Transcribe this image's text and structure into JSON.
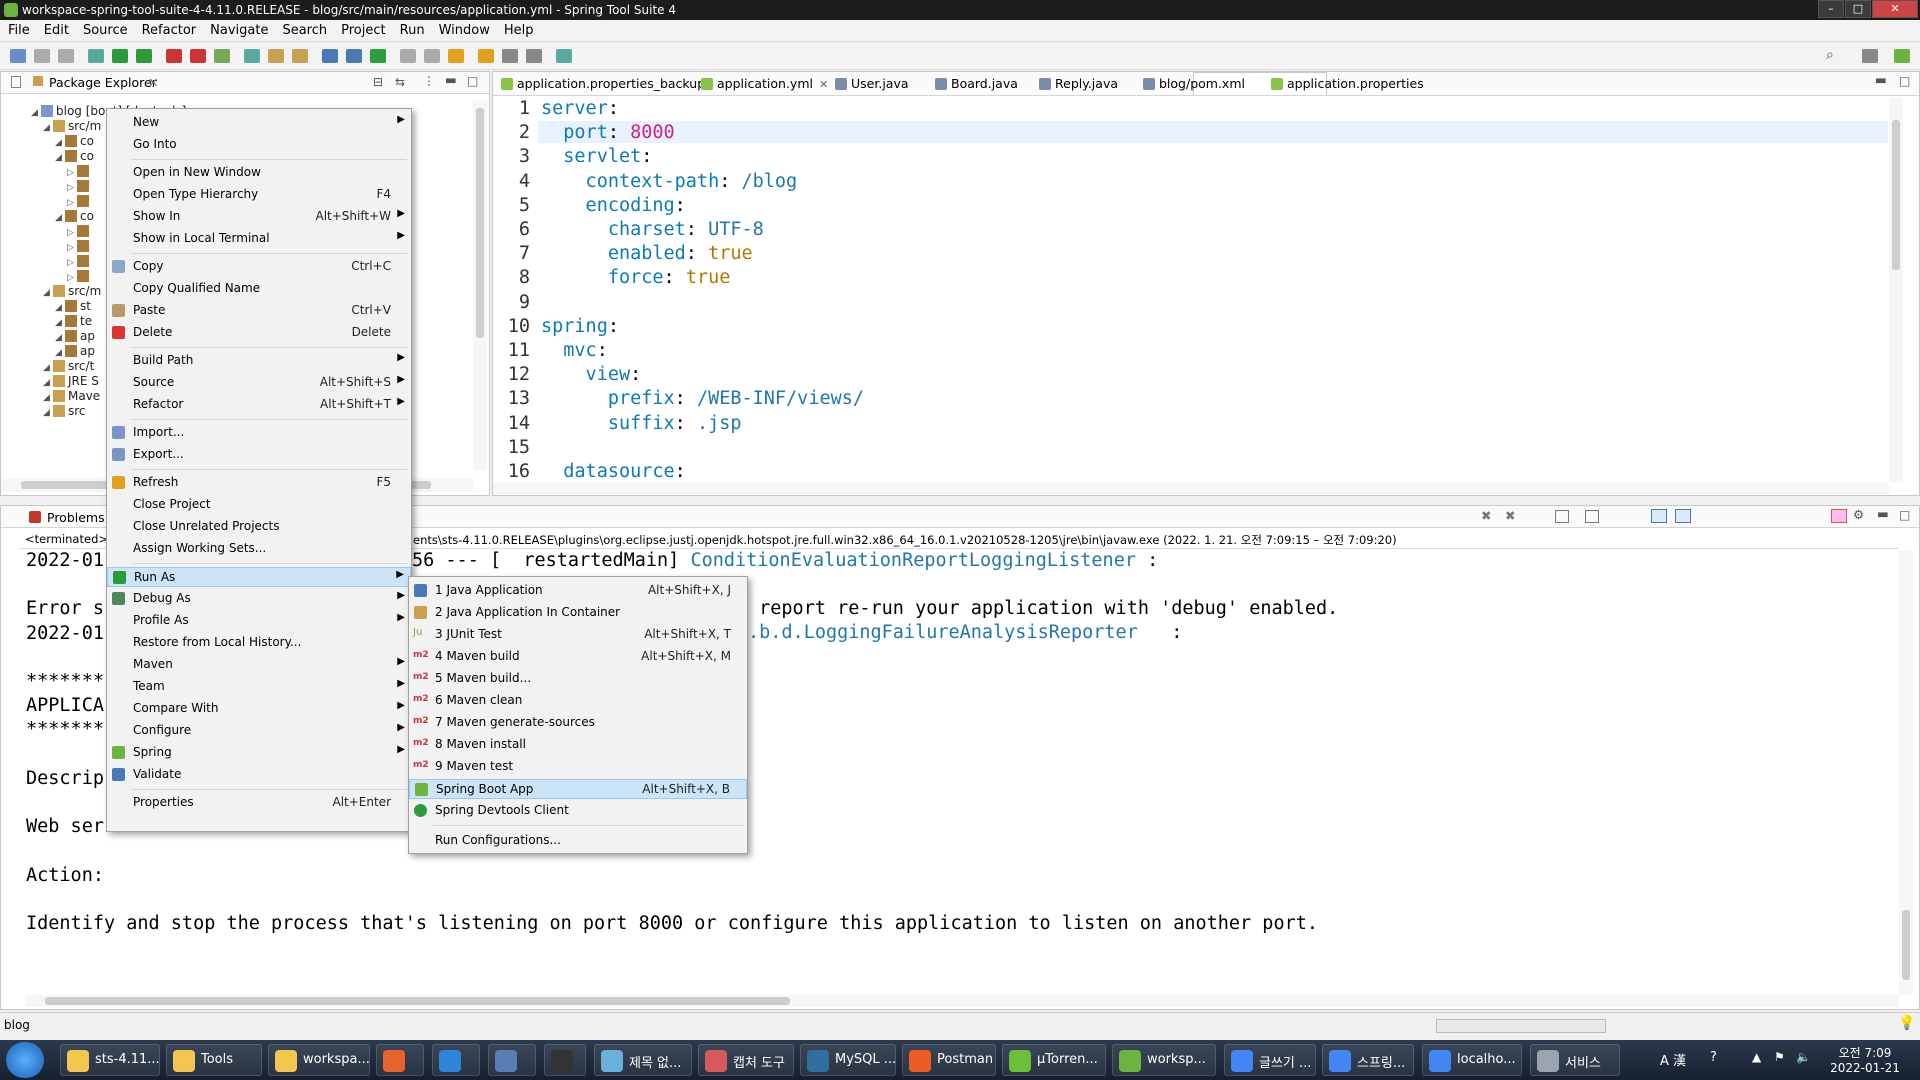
{
  "window": {
    "title": "workspace-spring-tool-suite-4-4.11.0.RELEASE - blog/src/main/resources/application.yml - Spring Tool Suite 4"
  },
  "menubar": [
    "File",
    "Edit",
    "Source",
    "Refactor",
    "Navigate",
    "Search",
    "Project",
    "Run",
    "Window",
    "Help"
  ],
  "package_explorer": {
    "tab_label": "Package Explorer",
    "tree": [
      {
        "label": "blog [boot] [devtools]",
        "indent": 0
      },
      {
        "label": "src/m",
        "indent": 1
      },
      {
        "label": "co",
        "indent": 2
      },
      {
        "label": "co",
        "indent": 2
      },
      {
        "label": "",
        "indent": 3
      },
      {
        "label": "",
        "indent": 3
      },
      {
        "label": "",
        "indent": 3
      },
      {
        "label": "co",
        "indent": 2
      },
      {
        "label": "",
        "indent": 3
      },
      {
        "label": "",
        "indent": 3
      },
      {
        "label": "",
        "indent": 3
      },
      {
        "label": "",
        "indent": 3
      },
      {
        "label": "src/m",
        "indent": 1
      },
      {
        "label": "st",
        "indent": 2
      },
      {
        "label": "te",
        "indent": 2
      },
      {
        "label": "ap",
        "indent": 2
      },
      {
        "label": "ap",
        "indent": 2
      },
      {
        "label": "src/t",
        "indent": 1
      },
      {
        "label": "JRE S",
        "indent": 1
      },
      {
        "label": "Mave",
        "indent": 1
      },
      {
        "label": "src",
        "indent": 1
      }
    ]
  },
  "editor": {
    "tabs": [
      {
        "label": "application.properties_backup",
        "color": "#8bc34a"
      },
      {
        "label": "application.yml",
        "color": "#8bc34a",
        "active": true
      },
      {
        "label": "User.java",
        "color": "#7a8ba8"
      },
      {
        "label": "Board.java",
        "color": "#7a8ba8"
      },
      {
        "label": "Reply.java",
        "color": "#7a8ba8"
      },
      {
        "label": "blog/pom.xml",
        "color": "#7a8ba8"
      },
      {
        "label": "application.properties",
        "color": "#8bc34a"
      }
    ],
    "close_glyph": "✕",
    "line_numbers": [
      "1",
      "2",
      "3",
      "4",
      "5",
      "6",
      "7",
      "8",
      "9",
      "10",
      "11",
      "12",
      "13",
      "14",
      "15",
      "16"
    ],
    "lines": [
      [
        {
          "t": "server",
          "c": "key"
        },
        {
          "t": ":",
          "c": ""
        }
      ],
      [
        {
          "t": "  port",
          "c": "key"
        },
        {
          "t": ": ",
          "c": ""
        },
        {
          "t": "8000",
          "c": "num"
        }
      ],
      [
        {
          "t": "  servlet",
          "c": "key"
        },
        {
          "t": ":",
          "c": ""
        }
      ],
      [
        {
          "t": "    context-path",
          "c": "key"
        },
        {
          "t": ": ",
          "c": ""
        },
        {
          "t": "/blog",
          "c": "str"
        }
      ],
      [
        {
          "t": "    encoding",
          "c": "key"
        },
        {
          "t": ":",
          "c": ""
        }
      ],
      [
        {
          "t": "      charset",
          "c": "key"
        },
        {
          "t": ": ",
          "c": ""
        },
        {
          "t": "UTF-8",
          "c": "str"
        }
      ],
      [
        {
          "t": "      enabled",
          "c": "key"
        },
        {
          "t": ": ",
          "c": ""
        },
        {
          "t": "true",
          "c": "bool"
        }
      ],
      [
        {
          "t": "      force",
          "c": "key"
        },
        {
          "t": ": ",
          "c": ""
        },
        {
          "t": "true",
          "c": "bool"
        }
      ],
      [],
      [
        {
          "t": "spring",
          "c": "key"
        },
        {
          "t": ":",
          "c": ""
        }
      ],
      [
        {
          "t": "  mvc",
          "c": "key"
        },
        {
          "t": ":",
          "c": ""
        }
      ],
      [
        {
          "t": "    view",
          "c": "key"
        },
        {
          "t": ":",
          "c": ""
        }
      ],
      [
        {
          "t": "      prefix",
          "c": "key"
        },
        {
          "t": ": ",
          "c": ""
        },
        {
          "t": "/WEB-INF/views/",
          "c": "str"
        }
      ],
      [
        {
          "t": "      suffix",
          "c": "key"
        },
        {
          "t": ": ",
          "c": ""
        },
        {
          "t": ".jsp",
          "c": "str"
        }
      ],
      [],
      [
        {
          "t": "  datasource",
          "c": "key"
        },
        {
          "t": ":",
          "c": ""
        }
      ]
    ]
  },
  "console": {
    "tab_label": "Problems",
    "terminated_label": "<terminated> b",
    "path_text": "ents\\sts-4.11.0.RELEASE\\plugins\\org.eclipse.justj.openjdk.hotspot.jre.full.win32.x86_64_16.0.1.v20210528-1205\\jre\\bin\\javaw.exe  (2022. 1. 21. 오전 7:09:15 – 오전 7:09:20)",
    "lines": [
      {
        "text": "2022-01",
        "ms": 56
      },
      {
        "text": "",
        "ms": 0
      },
      {
        "text": "Error s",
        "ms": 0
      },
      {
        "text": "2022-01",
        "ms": 0
      },
      {
        "text": "",
        "ms": 0
      },
      {
        "text": "*******",
        "ms": 0
      },
      {
        "text": "APPLICA",
        "ms": 0
      },
      {
        "text": "*******",
        "ms": 0
      },
      {
        "text": "",
        "ms": 0
      },
      {
        "text": "Descrip",
        "ms": 0
      },
      {
        "text": "",
        "ms": 0
      },
      {
        "text": "Web ser",
        "ms": 0
      },
      {
        "text": "",
        "ms": 0
      },
      {
        "text": "Action:",
        "ms": 0
      },
      {
        "text": "",
        "ms": 0
      },
      {
        "text": "Identify and stop the process that's listening on port 8000 or configure this application to listen on another port.",
        "ms": 0
      }
    ],
    "right_fragments": [
      {
        "text": "56 --- [  restartedMain] ",
        "cls": ""
      },
      {
        "text": "ConditionEvaluationReportLoggingListener",
        "cls": "str"
      },
      {
        "text": " :",
        "cls": ""
      }
    ],
    "fragment2": " report re-run your application with 'debug' enabled.",
    "fragment3a": ".b.d.LoggingFailureAnalysisReporter",
    "fragment3b": "   :"
  },
  "context_menu": {
    "items": [
      {
        "label": "New",
        "shortcut": "",
        "arrow": true,
        "icon": ""
      },
      {
        "label": "Go Into",
        "shortcut": "",
        "arrow": false,
        "icon": ""
      },
      {
        "sep": true
      },
      {
        "label": "Open in New Window",
        "shortcut": "",
        "arrow": false,
        "icon": ""
      },
      {
        "label": "Open Type Hierarchy",
        "shortcut": "F4",
        "arrow": false,
        "icon": ""
      },
      {
        "label": "Show In",
        "shortcut": "Alt+Shift+W",
        "arrow": true,
        "icon": ""
      },
      {
        "label": "Show in Local Terminal",
        "shortcut": "",
        "arrow": true,
        "icon": ""
      },
      {
        "sep": true
      },
      {
        "label": "Copy",
        "shortcut": "Ctrl+C",
        "arrow": false,
        "icon": "copy-icon"
      },
      {
        "label": "Copy Qualified Name",
        "shortcut": "",
        "arrow": false,
        "icon": ""
      },
      {
        "label": "Paste",
        "shortcut": "Ctrl+V",
        "arrow": false,
        "icon": "paste-icon"
      },
      {
        "label": "Delete",
        "shortcut": "Delete",
        "arrow": false,
        "icon": "delete-icon"
      },
      {
        "sep": true
      },
      {
        "label": "Build Path",
        "shortcut": "",
        "arrow": true,
        "icon": ""
      },
      {
        "label": "Source",
        "shortcut": "Alt+Shift+S",
        "arrow": true,
        "icon": ""
      },
      {
        "label": "Refactor",
        "shortcut": "Alt+Shift+T",
        "arrow": true,
        "icon": ""
      },
      {
        "sep": true
      },
      {
        "label": "Import...",
        "shortcut": "",
        "arrow": false,
        "icon": "import-icon"
      },
      {
        "label": "Export...",
        "shortcut": "",
        "arrow": false,
        "icon": "export-icon"
      },
      {
        "sep": true
      },
      {
        "label": "Refresh",
        "shortcut": "F5",
        "arrow": false,
        "icon": "refresh-icon"
      },
      {
        "label": "Close Project",
        "shortcut": "",
        "arrow": false,
        "icon": ""
      },
      {
        "label": "Close Unrelated Projects",
        "shortcut": "",
        "arrow": false,
        "icon": ""
      },
      {
        "label": "Assign Working Sets...",
        "shortcut": "",
        "arrow": false,
        "icon": ""
      },
      {
        "sep": true
      },
      {
        "label": "Run As",
        "shortcut": "",
        "arrow": true,
        "icon": "run-icon",
        "highlight": true
      },
      {
        "label": "Debug As",
        "shortcut": "",
        "arrow": true,
        "icon": "debug-icon"
      },
      {
        "label": "Profile As",
        "shortcut": "",
        "arrow": true,
        "icon": ""
      },
      {
        "label": "Restore from Local History...",
        "shortcut": "",
        "arrow": false,
        "icon": ""
      },
      {
        "label": "Maven",
        "shortcut": "",
        "arrow": true,
        "icon": ""
      },
      {
        "label": "Team",
        "shortcut": "",
        "arrow": true,
        "icon": ""
      },
      {
        "label": "Compare With",
        "shortcut": "",
        "arrow": true,
        "icon": ""
      },
      {
        "label": "Configure",
        "shortcut": "",
        "arrow": true,
        "icon": ""
      },
      {
        "label": "Spring",
        "shortcut": "",
        "arrow": true,
        "icon": "spring-icon"
      },
      {
        "label": "Validate",
        "shortcut": "",
        "arrow": false,
        "icon": "check-icon"
      },
      {
        "sep": true
      },
      {
        "label": "Properties",
        "shortcut": "Alt+Enter",
        "arrow": false,
        "icon": ""
      }
    ]
  },
  "run_as_menu": {
    "items": [
      {
        "label": "1 Java Application",
        "shortcut": "Alt+Shift+X, J",
        "icon": "java-app-icon"
      },
      {
        "label": "2 Java Application In Container",
        "shortcut": "",
        "icon": "container-icon"
      },
      {
        "label": "3 JUnit Test",
        "shortcut": "Alt+Shift+X, T",
        "icon": "junit-icon"
      },
      {
        "label": "4 Maven build",
        "shortcut": "Alt+Shift+X, M",
        "icon": "m2-icon"
      },
      {
        "label": "5 Maven build...",
        "shortcut": "",
        "icon": "m2-icon"
      },
      {
        "label": "6 Maven clean",
        "shortcut": "",
        "icon": "m2-icon"
      },
      {
        "label": "7 Maven generate-sources",
        "shortcut": "",
        "icon": "m2-icon"
      },
      {
        "label": "8 Maven install",
        "shortcut": "",
        "icon": "m2-icon"
      },
      {
        "label": "9 Maven test",
        "shortcut": "",
        "icon": "m2-icon"
      },
      {
        "label": "Spring Boot App",
        "shortcut": "Alt+Shift+X, B",
        "icon": "spring-boot-icon",
        "highlight": true
      },
      {
        "label": "Spring Devtools Client",
        "shortcut": "",
        "icon": "devtools-icon"
      },
      {
        "sep": true
      },
      {
        "label": "Run Configurations...",
        "shortcut": "",
        "icon": ""
      }
    ],
    "m2_label": "m2",
    "junit_label": "Ju"
  },
  "statusbar": {
    "text": "blog"
  },
  "taskbar": {
    "items": [
      {
        "label": "sts-4.11...",
        "color": "#f3c74f"
      },
      {
        "label": "Tools",
        "color": "#f3c74f"
      },
      {
        "label": "workspa...",
        "color": "#f3c74f"
      },
      {
        "label": "",
        "color": "#e8632b"
      },
      {
        "label": "",
        "color": "#2f86d8"
      },
      {
        "label": "",
        "color": "#5a7db5"
      },
      {
        "label": "",
        "color": "#333333"
      },
      {
        "label": "제목 없...",
        "color": "#6ab0de"
      },
      {
        "label": "캡처 도구",
        "color": "#d65a5a"
      },
      {
        "label": "MySQL ...",
        "color": "#2f6f9f"
      },
      {
        "label": "Postman",
        "color": "#ef5b25"
      },
      {
        "label": "µTorren...",
        "color": "#6bbf3b"
      },
      {
        "label": "worksp...",
        "color": "#6db33f"
      },
      {
        "label": "글쓰기 ...",
        "color": "#4285f4"
      },
      {
        "label": "스프링...",
        "color": "#4285f4"
      },
      {
        "label": "localho...",
        "color": "#4285f4"
      },
      {
        "label": "서비스",
        "color": "#9aa5b1"
      }
    ],
    "tray_ime": "A 漢",
    "clock_time": "오전 7:09",
    "clock_date": "2022-01-21"
  }
}
